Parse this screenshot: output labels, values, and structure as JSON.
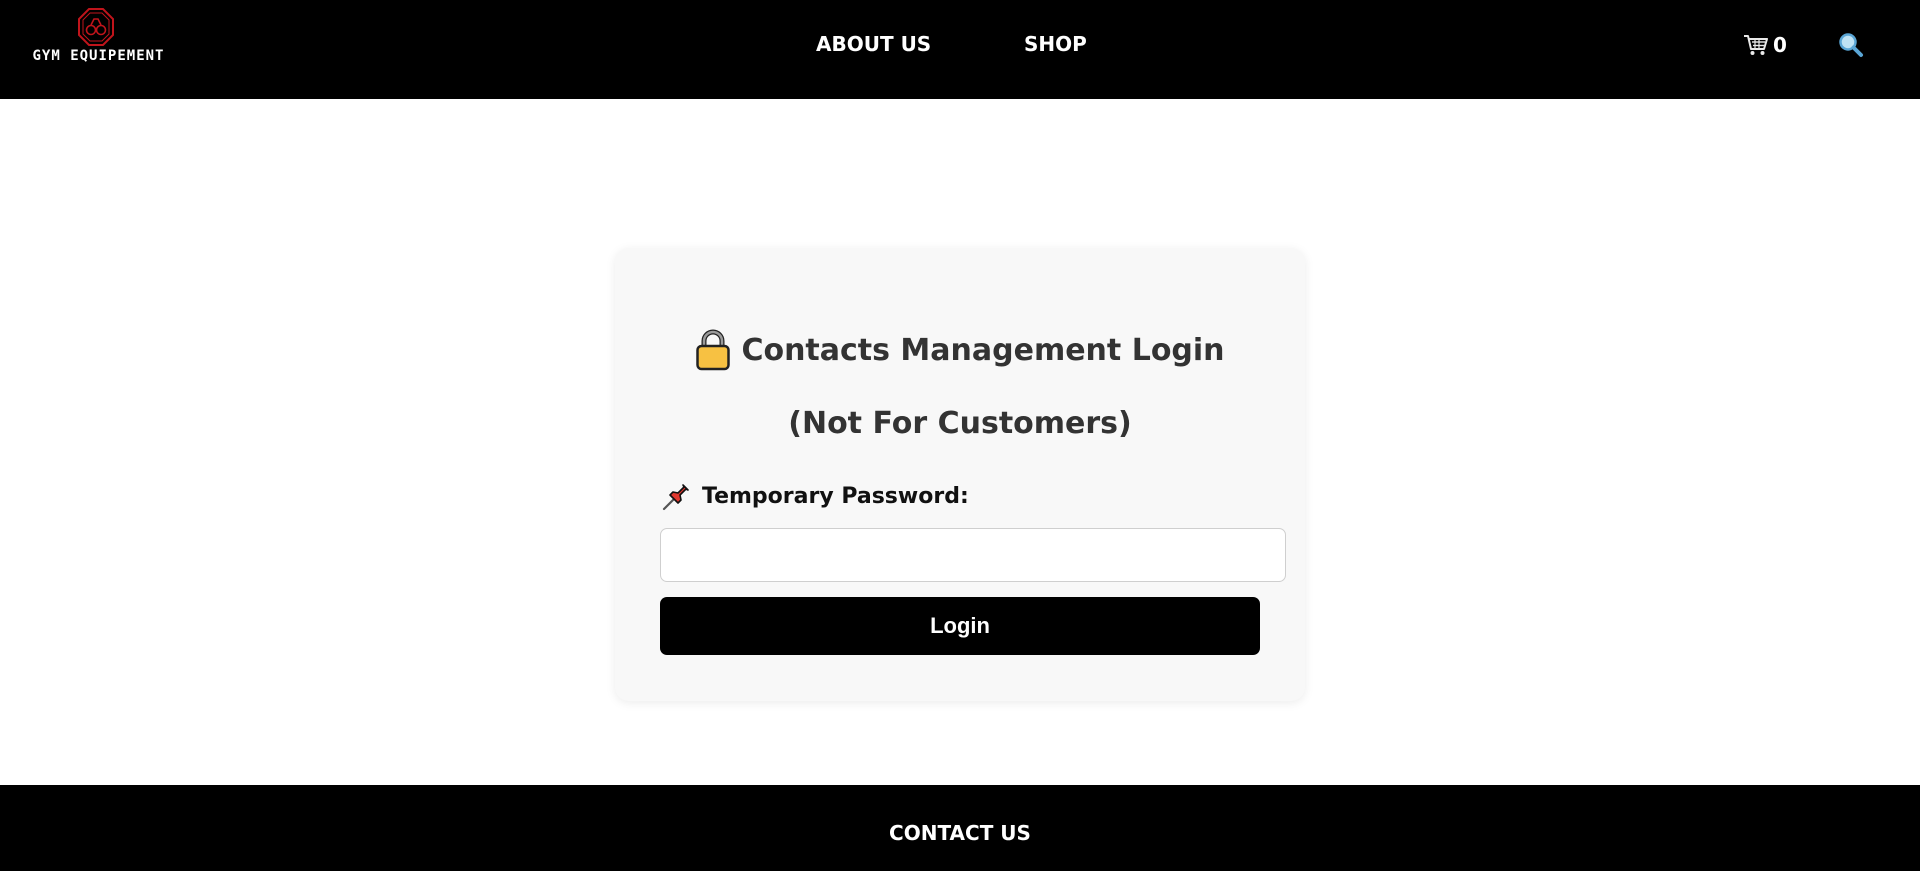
{
  "header": {
    "logo_text": "GYM EQUIPEMENT",
    "nav": {
      "about": "ABOUT US",
      "shop": "SHOP"
    },
    "cart_count": "0",
    "icons": {
      "logo": "gym-logo-icon",
      "cart": "cart-icon",
      "search": "search-icon"
    }
  },
  "login": {
    "title": "Contacts Management Login",
    "subtitle": "(Not For Customers)",
    "password_label": "Temporary Password:",
    "password_value": "",
    "button_label": "Login",
    "icons": {
      "title": "lock-icon",
      "label": "pushpin-icon"
    }
  },
  "footer": {
    "contact": "CONTACT US"
  },
  "colors": {
    "bar_background": "#000000",
    "card_background": "#f8f8f8",
    "logo_accent": "#c0141b",
    "lock_body": "#f7c142"
  }
}
